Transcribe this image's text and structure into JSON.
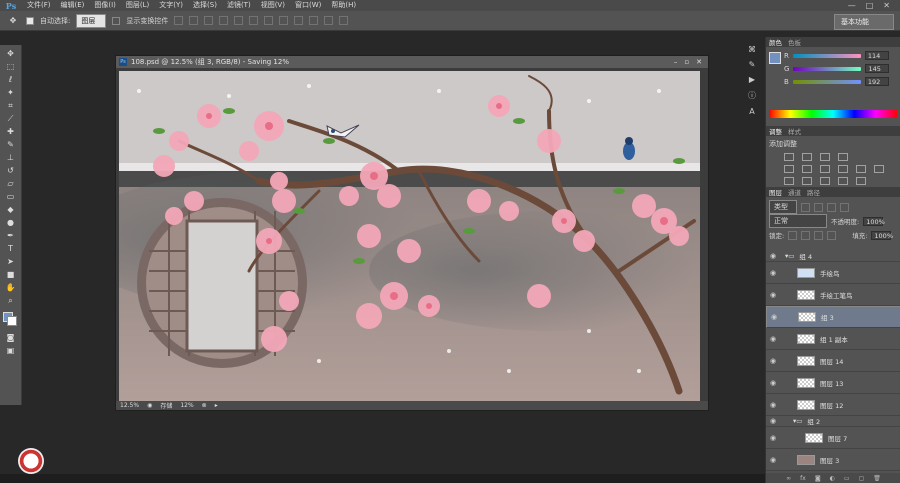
{
  "menubar": {
    "logo": "Ps",
    "items": [
      "文件(F)",
      "编辑(E)",
      "图像(I)",
      "图层(L)",
      "文字(Y)",
      "选择(S)",
      "滤镜(T)",
      "视图(V)",
      "窗口(W)",
      "帮助(H)"
    ],
    "controls": [
      "—",
      "□",
      "✕"
    ]
  },
  "optbar": {
    "auto_select_label": "自动选择:",
    "auto_select_value": "图层",
    "show_transform_label": "显示变换控件",
    "workspace": "基本功能"
  },
  "document": {
    "title": "108.psd @ 12.5% (组 3, RGB/8) - Saving 12%",
    "zoom": "12.5%",
    "status": "存储",
    "progress_text": "12%"
  },
  "color_panel": {
    "tabs": [
      "颜色",
      "色板"
    ],
    "channels": [
      {
        "label": "R",
        "value": "114"
      },
      {
        "label": "G",
        "value": "145"
      },
      {
        "label": "B",
        "value": "192"
      }
    ]
  },
  "adjust_panel": {
    "tabs": [
      "调整",
      "样式"
    ],
    "heading": "添加调整"
  },
  "layers_panel": {
    "tabs": [
      "图层",
      "通道",
      "路径"
    ],
    "kind_filter": "类型",
    "blend_mode": "正常",
    "opacity_label": "不透明度:",
    "opacity_value": "100%",
    "lock_label": "锁定:",
    "fill_label": "填充:",
    "fill_value": "100%",
    "layers": [
      {
        "name": "组 4",
        "type": "group"
      },
      {
        "name": "手绘鸟",
        "type": "layer"
      },
      {
        "name": "手绘工笔鸟",
        "type": "layer"
      },
      {
        "name": "组 3",
        "type": "layer",
        "selected": true
      },
      {
        "name": "组 1 副本",
        "type": "layer"
      },
      {
        "name": "图层 14",
        "type": "layer"
      },
      {
        "name": "图层 13",
        "type": "layer"
      },
      {
        "name": "图层 12",
        "type": "layer"
      },
      {
        "name": "组 2",
        "type": "group"
      },
      {
        "name": "图层 7",
        "type": "layer"
      },
      {
        "name": "图层 3",
        "type": "layer"
      }
    ]
  },
  "colors": {
    "foreground": "#7291c0",
    "accent": "#5aa4dd"
  }
}
